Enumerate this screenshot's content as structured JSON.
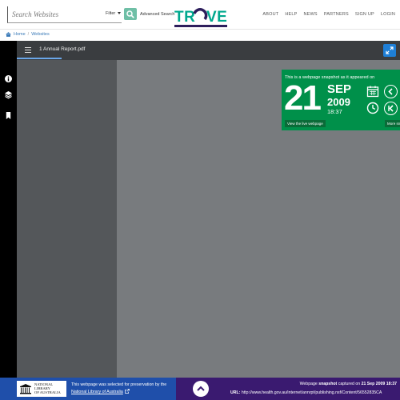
{
  "header": {
    "search_placeholder": "Search Websites",
    "filter_label": "Filter",
    "advanced_search_label": "Advanced Search",
    "logo_text": "TROVE",
    "nav": [
      "ABOUT",
      "HELP",
      "NEWS",
      "PARTNERS",
      "SIGN UP",
      "LOGIN"
    ]
  },
  "breadcrumb": {
    "home": "Home",
    "separator": "/",
    "current": "Websites"
  },
  "viewer": {
    "file_name": "1 Annual Report.pdf",
    "accent_color": "#1e7fd6"
  },
  "snapshot": {
    "caption": "This is a webpage snapshot as it appeared on",
    "day": "21",
    "month": "SEP",
    "year": "2009",
    "time": "18:37",
    "live_button": "View the live webpage",
    "more_button": "More sn",
    "background_color": "#00904a"
  },
  "footer": {
    "nla_logo_lines": [
      "NATIONAL",
      "LIBRARY",
      "OF AUSTRALIA"
    ],
    "selected_text": "This webpage was selected for preservation by the",
    "selected_link": "National Library of Australia",
    "capture_prefix": "Webpage",
    "capture_word": "snapshot",
    "capture_mid": "captured on",
    "capture_date": "21 Sep 2009 18:37",
    "url_label": "URL:",
    "url_value": "http://www.health.gov.au/internet/annrpt/publishing.nsf/Content/56552835CA"
  }
}
